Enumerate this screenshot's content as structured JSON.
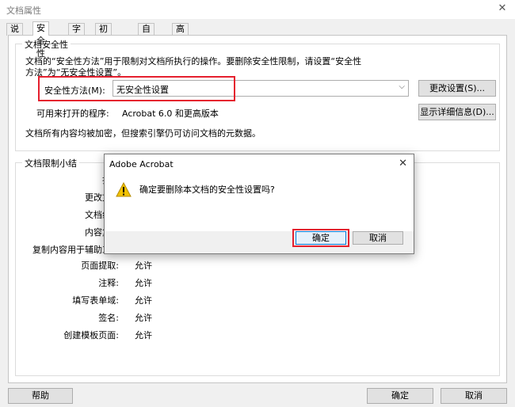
{
  "window": {
    "title": "文档属性",
    "close_glyph": "✕"
  },
  "tabs": [
    {
      "label": "说明"
    },
    {
      "label": "安全性"
    },
    {
      "label": "字体"
    },
    {
      "label": "初始视图"
    },
    {
      "label": "自定义"
    },
    {
      "label": "高级"
    }
  ],
  "security": {
    "legend": "文档安全性",
    "desc_line1": "文档的“安全性方法”用于限制对文档所执行的操作。要删除安全性限制，请设置“安全性",
    "desc_line2": "方法”为“无安全性设置”。",
    "method_label": "安全性方法(M):",
    "method_value": "无安全性设置",
    "change_btn": "更改设置(S)...",
    "open_label": "可用来打开的程序:",
    "open_value": "Acrobat 6.0 和更高版本",
    "details_btn": "显示详细信息(D)...",
    "note": "文档所有内容均被加密，但搜索引擎仍可访问文档的元数据。"
  },
  "restrictions": {
    "legend": "文档限制小结",
    "rows": [
      {
        "label": "打",
        "value": ""
      },
      {
        "label": "更改文",
        "value": ""
      },
      {
        "label": "文档组",
        "value": ""
      },
      {
        "label": "内容复",
        "value": ""
      },
      {
        "label": "复制内容用于辅助工",
        "value": ""
      },
      {
        "label": "页面提取:",
        "value": "允许"
      },
      {
        "label": "注释:",
        "value": "允许"
      },
      {
        "label": "填写表单域:",
        "value": "允许"
      },
      {
        "label": "签名:",
        "value": "允许"
      },
      {
        "label": "创建模板页面:",
        "value": "允许"
      }
    ]
  },
  "footer": {
    "help": "帮助",
    "ok": "确定",
    "cancel": "取消"
  },
  "dialog": {
    "title": "Adobe Acrobat",
    "close_glyph": "✕",
    "message": "确定要删除本文档的安全性设置吗?",
    "ok": "确定",
    "cancel": "取消"
  },
  "colors": {
    "highlight": "#e5202e",
    "warning": "#f2c200"
  }
}
